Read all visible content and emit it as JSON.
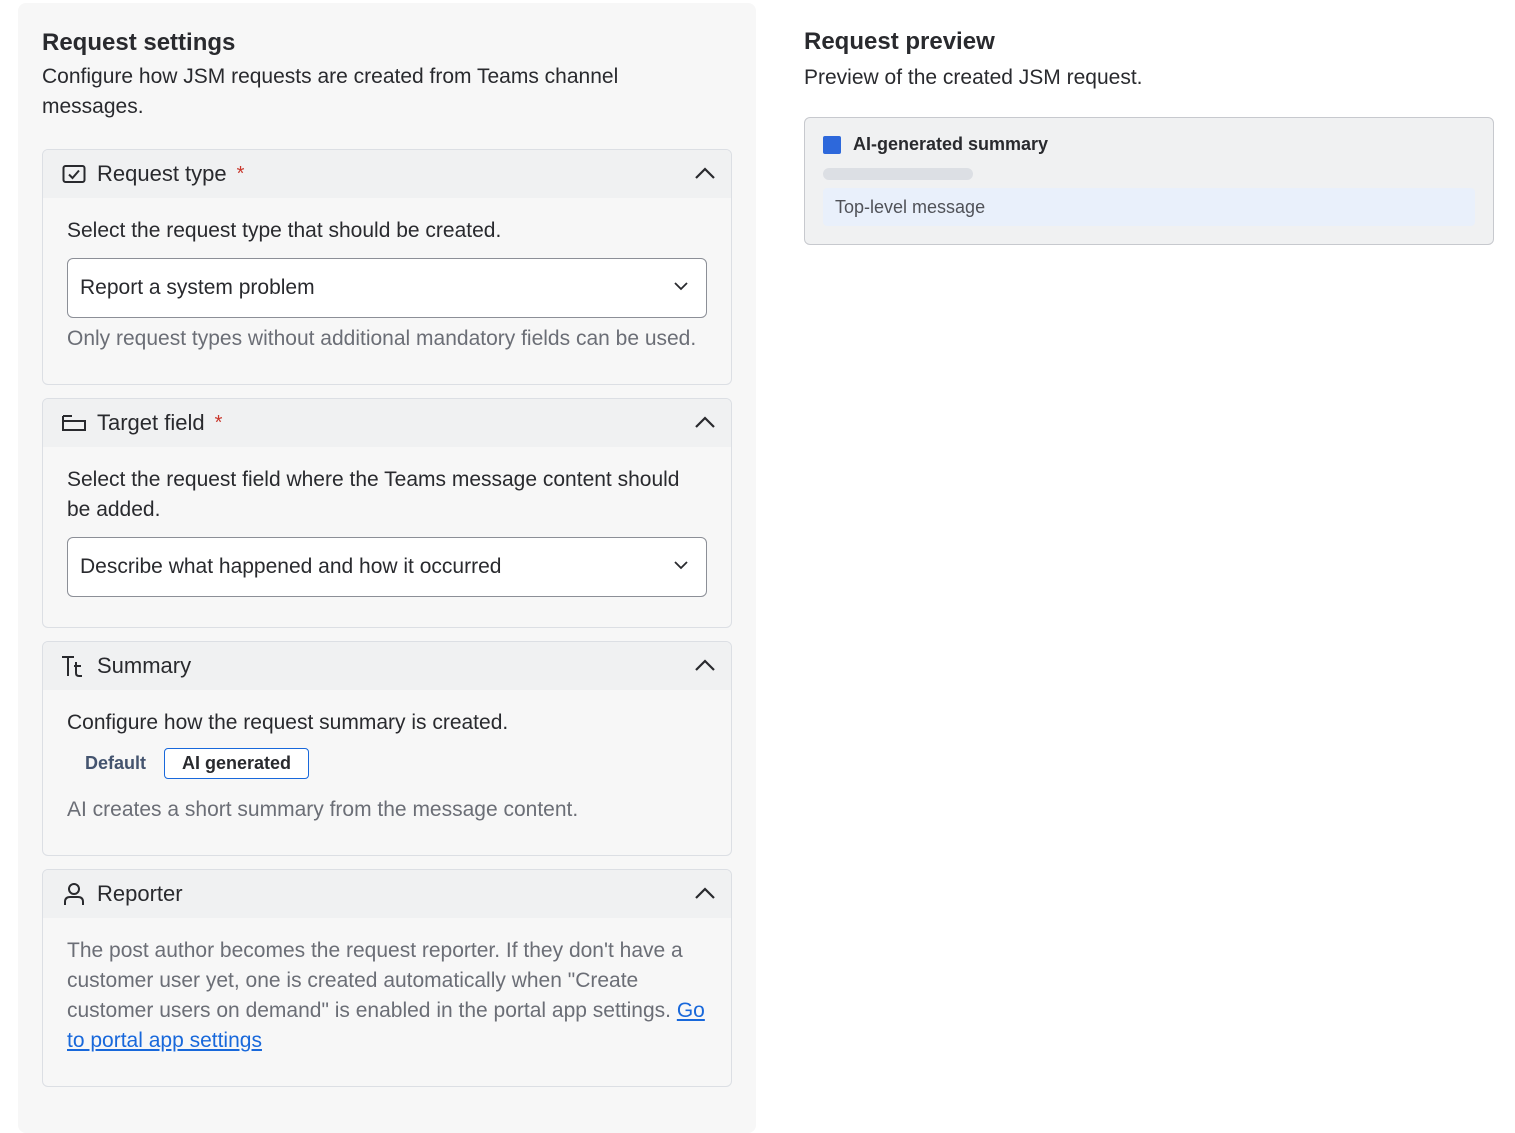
{
  "settings": {
    "title": "Request settings",
    "description": "Configure how JSM requests are created from Teams channel messages.",
    "sections": {
      "request_type": {
        "title": "Request type",
        "required_mark": "*",
        "icon": "checkbox-icon",
        "text": "Select the request type that should be created.",
        "select_value": "Report a system problem",
        "helper": "Only request types without additional mandatory fields can be used."
      },
      "target_field": {
        "title": "Target field",
        "required_mark": "*",
        "icon": "field-icon",
        "text": "Select the request field where the Teams message content should be added.",
        "select_value": "Describe what happened and how it occurred"
      },
      "summary": {
        "title": "Summary",
        "icon": "text-icon",
        "text": "Configure how the request summary is created.",
        "options": [
          "Default",
          "AI generated"
        ],
        "selected": "AI generated",
        "helper": "AI creates a short summary from the message content."
      },
      "reporter": {
        "title": "Reporter",
        "icon": "person-icon",
        "text": "The post author becomes the request reporter. If they don't have a customer user yet, one is created automatically when \"Create customer users on demand\" is enabled in the portal app settings.",
        "link": "Go to portal app settings"
      }
    }
  },
  "preview": {
    "title": "Request preview",
    "description": "Preview of the created JSM request.",
    "summary_label": "AI-generated summary",
    "message_label": "Top-level message",
    "accent_color": "#2d68db"
  }
}
